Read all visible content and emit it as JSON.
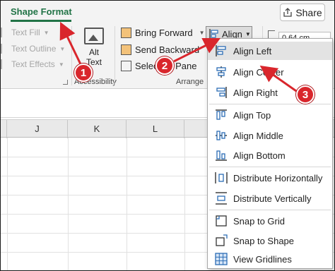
{
  "ribbon": {
    "active_tab": "Shape Format",
    "share_label": "Share",
    "wordart": {
      "text_fill": "Text Fill",
      "text_outline": "Text Outline",
      "text_effects": "Text Effects"
    },
    "accessibility": {
      "alt_text_line1": "Alt",
      "alt_text_line2": "Text",
      "group_label": "Accessibility"
    },
    "arrange": {
      "bring_forward": "Bring Forward",
      "send_backward": "Send Backward",
      "selection_pane": "Selection Pane",
      "group_label": "Arrange"
    },
    "align_button": "Align",
    "size_value": "0.64 cm"
  },
  "grid": {
    "columns": [
      "J",
      "K",
      "L"
    ]
  },
  "align_menu": {
    "items": [
      {
        "label": "Align Left",
        "icon": "align-left-icon"
      },
      {
        "label": "Align Center",
        "icon": "align-center-icon"
      },
      {
        "label": "Align Right",
        "icon": "align-right-icon"
      },
      {
        "label": "Align Top",
        "icon": "align-top-icon"
      },
      {
        "label": "Align Middle",
        "icon": "align-middle-icon"
      },
      {
        "label": "Align Bottom",
        "icon": "align-bottom-icon"
      },
      {
        "label": "Distribute Horizontally",
        "icon": "distribute-horizontally-icon"
      },
      {
        "label": "Distribute Vertically",
        "icon": "distribute-vertically-icon"
      },
      {
        "label": "Snap to Grid",
        "icon": "snap-to-grid-icon"
      },
      {
        "label": "Snap to Shape",
        "icon": "snap-to-shape-icon"
      },
      {
        "label": "View Gridlines",
        "icon": "view-gridlines-icon"
      }
    ]
  },
  "callouts": [
    "1",
    "2",
    "3"
  ],
  "colors": {
    "accent_green": "#217346",
    "callout_red": "#d9262c",
    "icon_blue": "#2b6cb5"
  }
}
